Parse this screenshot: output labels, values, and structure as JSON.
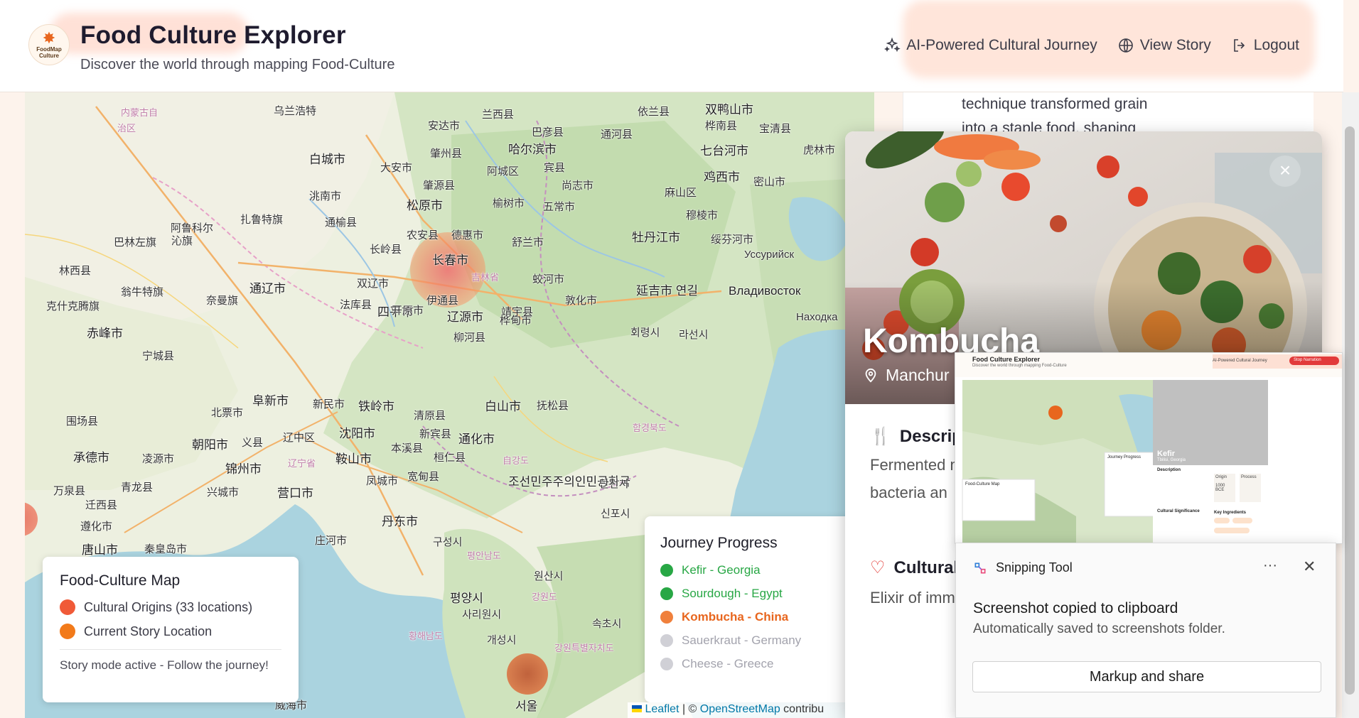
{
  "header": {
    "logo_text": "FoodMap Culture",
    "title": "Food Culture Explorer",
    "subtitle": "Discover the world through mapping Food-Culture",
    "nav": [
      {
        "label": "AI-Powered Cultural Journey",
        "icon": "sparkles-icon"
      },
      {
        "label": "View Story",
        "icon": "globe-icon"
      },
      {
        "label": "Logout",
        "icon": "logout-icon"
      }
    ]
  },
  "map": {
    "cities": [
      "内蒙古自",
      "治区",
      "乌兰浩特",
      "安达市",
      "兰西县",
      "依兰县",
      "双鸭山市",
      "桦南县",
      "宝清县",
      "哈尔滨市",
      "巴彦县",
      "通河县",
      "白城市",
      "大安市",
      "肇州县",
      "阿城区",
      "七台河市",
      "宾县",
      "尚志市",
      "鸡西市",
      "密山市",
      "虎林市",
      "洮南市",
      "肇源县",
      "松原市",
      "榆树市",
      "五常市",
      "麻山区",
      "穆棱市",
      "阿鲁科尔",
      "扎鲁特旗",
      "通榆县",
      "农安县",
      "德惠市",
      "长春市",
      "舒兰市",
      "牡丹江市",
      "绥芬河市",
      "Уссурийск",
      "巴林左旗",
      "沁旗",
      "长岭县",
      "吉林省",
      "蛟河市",
      "林西县",
      "翁牛特旗",
      "通辽市",
      "双辽市",
      "伊通县",
      "辽源市",
      "敦化市",
      "延吉市 연길",
      "Владивосток",
      "克什克腾旗",
      "奈曼旗",
      "四平市",
      "桦甸市",
      "Находка",
      "赤峰市",
      "法库县",
      "开原市",
      "柳河县",
      "靖宇县",
      "회령시",
      "라선시",
      "宁城县",
      "阜新市",
      "新民市",
      "铁岭市",
      "清原县",
      "白山市",
      "抚松县",
      "北票市",
      "沈阳市",
      "新宾县",
      "通化市",
      "함경북도",
      "围场县",
      "朝阳市",
      "义县",
      "辽中区",
      "辽宁省",
      "本溪县",
      "桓仁县",
      "万泉县",
      "承德市",
      "凌源市",
      "锦州市",
      "鞍山市",
      "凤城市",
      "宽甸县",
      "조선민주주의인민공화국",
      "단천시",
      "青龙县",
      "兴城市",
      "营口市",
      "自강도",
      "丹东市",
      "신포시",
      "迁西县",
      "遵化市",
      "唐山市",
      "秦皇岛市",
      "庄河市",
      "구성시",
      "평안남도",
      "원산시",
      "평양시",
      "사리원시",
      "강원도",
      "황해남도",
      "속초시",
      "개성시",
      "강원특별자치도",
      "서울",
      "威海市"
    ]
  },
  "legend": {
    "title": "Food-Culture Map",
    "items": [
      {
        "label": "Cultural Origins (33 locations)",
        "color": "#f05a38"
      },
      {
        "label": "Current Story Location",
        "color": "#f27a1a"
      }
    ],
    "note": "Story mode active - Follow the journey!"
  },
  "journey": {
    "title": "Journey Progress",
    "steps": [
      {
        "label": "Kefir - Georgia",
        "state": "done",
        "color": "#28a745"
      },
      {
        "label": "Sourdough - Egypt",
        "state": "done",
        "color": "#28a745"
      },
      {
        "label": "Kombucha - China",
        "state": "current",
        "color": "#f0803c"
      },
      {
        "label": "Sauerkraut - Germany",
        "state": "pending",
        "color": "#d0d0d6"
      },
      {
        "label": "Cheese - Greece",
        "state": "pending",
        "color": "#d0d0d6"
      }
    ]
  },
  "attribution": {
    "leaflet": "Leaflet",
    "sep": " | © ",
    "osm": "OpenStreetMap",
    "rest": " contribu"
  },
  "background_panel": {
    "text": "technique transformed grain into a staple food, shaping civilizations"
  },
  "card": {
    "title": "Kombucha",
    "location": "Manchur",
    "description_heading": "Descrip",
    "description": "Fermented made using (symbiotic bacteria an",
    "cultural_heading": "Cultural",
    "cultural": "Elixir of imm represents between yi"
  },
  "snip_preview": {
    "title": "Food Culture Explorer",
    "subtitle": "Discover the world through mapping Food-Culture",
    "nav": "AI-Powered Cultural Journey",
    "button": "Stop Narration",
    "card_title": "Kefir",
    "card_loc": "Tbilisi, Georgia",
    "legend_title": "Food-Culture Map",
    "journey_title": "Journey Progress",
    "desc_head": "Description",
    "origin": "Origin",
    "origin_val": "1000 BCE",
    "process": "Process",
    "sig_head": "Cultural Significance",
    "keys_head": "Key Ingredients"
  },
  "toast": {
    "app": "Snipping Tool",
    "message": "Screenshot copied to clipboard",
    "detail": "Automatically saved to screenshots folder.",
    "button": "Markup and share",
    "more": "···",
    "close": "✕"
  }
}
